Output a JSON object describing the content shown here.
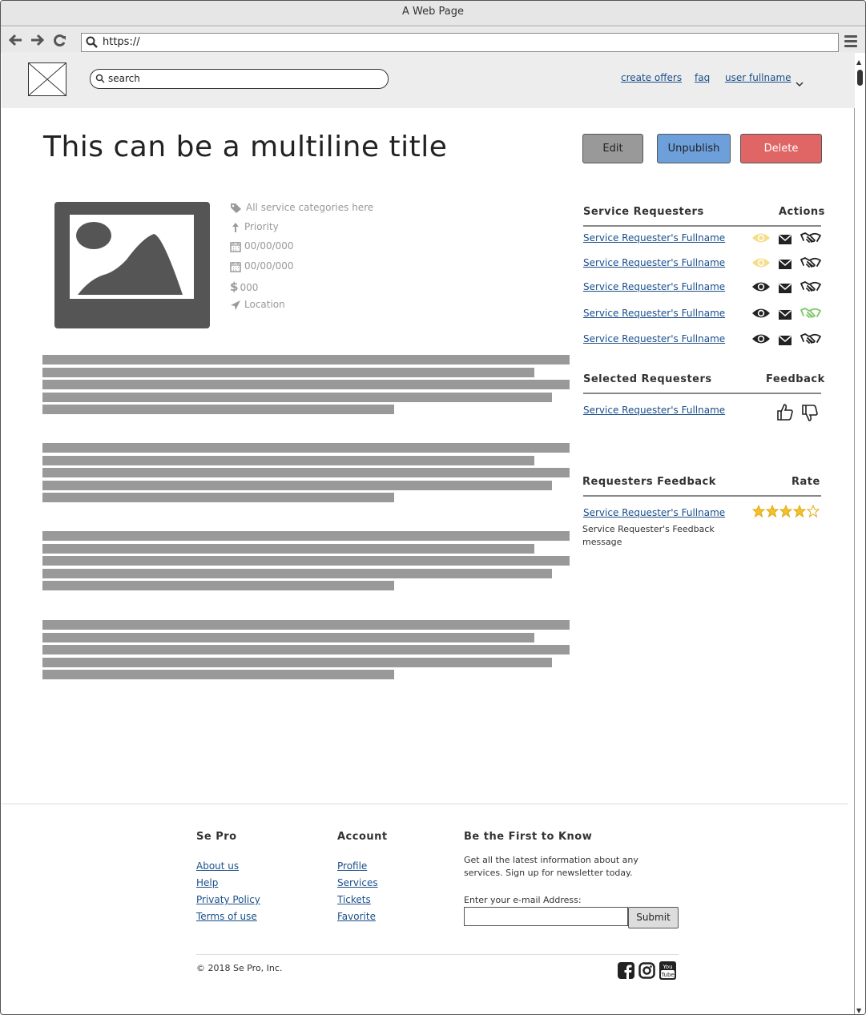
{
  "browser": {
    "window_title": "A Web Page",
    "url": "https://"
  },
  "header": {
    "search_placeholder": "search",
    "links": [
      "create offers",
      "faq",
      "user fullname"
    ]
  },
  "page": {
    "title": "This can be a multiline title",
    "buttons": {
      "edit": "Edit",
      "unpublish": "Unpublish",
      "delete": "Delete"
    },
    "colors": {
      "edit": "#999999",
      "unpublish": "#6d9fdb",
      "delete": "#e06666"
    }
  },
  "details": {
    "categories": "All service categories here",
    "priority": "Priority",
    "date1": "00/00/000",
    "date2": "00/00/000",
    "price": "000",
    "location": "Location"
  },
  "service_requesters": {
    "heading": "Service Requesters",
    "actions_heading": "Actions",
    "rows": [
      {
        "name": "Service Requester's Fullname",
        "viewed": true,
        "hired": false
      },
      {
        "name": "Service Requester's Fullname",
        "viewed": true,
        "hired": false
      },
      {
        "name": "Service Requester's Fullname",
        "viewed": false,
        "hired": false
      },
      {
        "name": "Service Requester's Fullname",
        "viewed": false,
        "hired": true
      },
      {
        "name": "Service Requester's Fullname",
        "viewed": false,
        "hired": false
      }
    ]
  },
  "selected_requesters": {
    "heading": "Selected Requesters",
    "feedback_heading": "Feedback",
    "rows": [
      {
        "name": "Service Requester's Fullname"
      }
    ]
  },
  "requesters_feedback": {
    "heading": "Requesters Feedback",
    "rate_heading": "Rate",
    "rows": [
      {
        "name": "Service Requester's Fullname",
        "message": "Service Requester's Feedback message",
        "rating": 4,
        "max": 5
      }
    ]
  },
  "footer": {
    "col1": {
      "heading": "Se Pro",
      "links": [
        "About us",
        "Help",
        "Privaty Policy",
        "Terms of use"
      ]
    },
    "col2": {
      "heading": "Account",
      "links": [
        "Profile",
        "Services",
        "Tickets",
        "Favorite"
      ]
    },
    "col3": {
      "heading": "Be the First to Know",
      "text1": "Get all the latest information about any",
      "text2": "services. Sign up for newsletter today.",
      "email_label": "Enter your e-mail Address:",
      "submit": "Submit"
    },
    "copyright": "© 2018 Se Pro, Inc.",
    "social": [
      "facebook-icon",
      "instagram-icon",
      "youtube-icon"
    ]
  }
}
